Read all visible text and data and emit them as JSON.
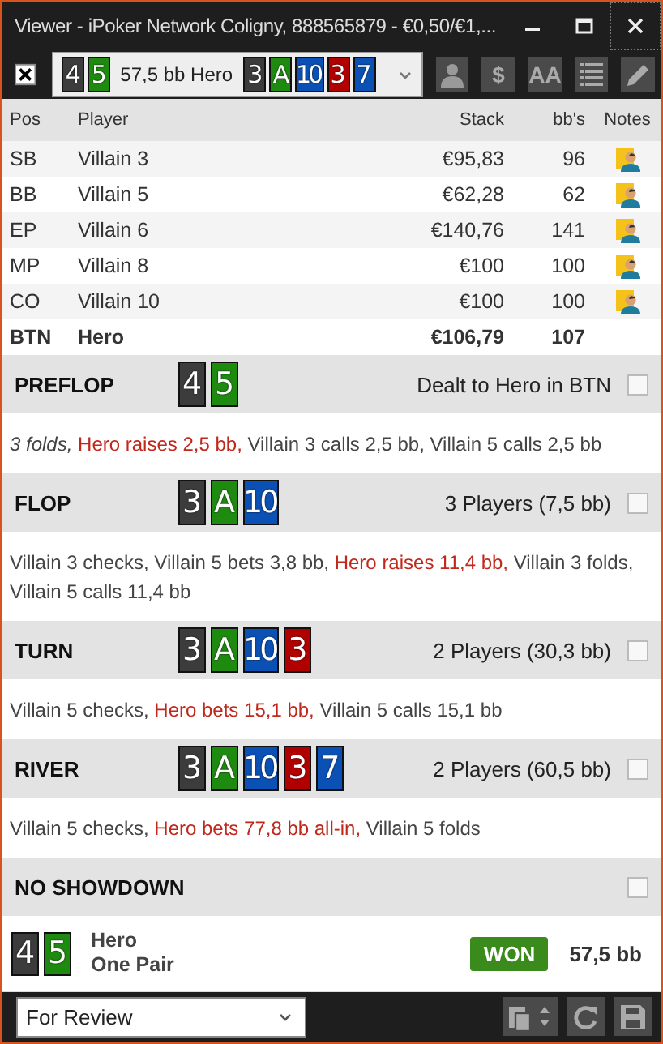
{
  "window": {
    "title": "Viewer - iPoker Network Coligny, 888565879 - €0,50/€1,..."
  },
  "toolbar": {
    "hand_selector": {
      "hero_cards": [
        {
          "rank": "4",
          "color": "#3c3c3c"
        },
        {
          "rank": "5",
          "color": "#1f8a10"
        }
      ],
      "label": "57,5 bb Hero",
      "board": [
        {
          "rank": "3",
          "color": "#3c3c3c"
        },
        {
          "rank": "A",
          "color": "#1f8a10"
        },
        {
          "rank": "10",
          "color": "#0b50b4"
        },
        {
          "rank": "3",
          "color": "#b10000"
        },
        {
          "rank": "7",
          "color": "#0b50b4"
        }
      ]
    },
    "buttons": [
      {
        "kind": "person"
      },
      {
        "kind": "text",
        "label": "$"
      },
      {
        "kind": "text",
        "label": "AA"
      },
      {
        "kind": "list"
      },
      {
        "kind": "pencil"
      }
    ]
  },
  "table": {
    "columns": [
      "Pos",
      "Player",
      "Stack",
      "bb's",
      "Notes"
    ],
    "rows": [
      {
        "pos": "SB",
        "player": "Villain 3",
        "stack": "€95,83",
        "bb": "96",
        "note": true,
        "hero": false
      },
      {
        "pos": "BB",
        "player": "Villain 5",
        "stack": "€62,28",
        "bb": "62",
        "note": true,
        "hero": false
      },
      {
        "pos": "EP",
        "player": "Villain 6",
        "stack": "€140,76",
        "bb": "141",
        "note": true,
        "hero": false
      },
      {
        "pos": "MP",
        "player": "Villain 8",
        "stack": "€100",
        "bb": "100",
        "note": true,
        "hero": false
      },
      {
        "pos": "CO",
        "player": "Villain 10",
        "stack": "€100",
        "bb": "100",
        "note": true,
        "hero": false
      },
      {
        "pos": "BTN",
        "player": "Hero",
        "stack": "€106,79",
        "bb": "107",
        "note": false,
        "hero": true
      }
    ]
  },
  "streets": [
    {
      "name": "PREFLOP",
      "cards": [
        {
          "rank": "4",
          "color": "#3c3c3c"
        },
        {
          "rank": "5",
          "color": "#1f8a10"
        }
      ],
      "info": "Dealt to Hero in BTN",
      "checked": false,
      "actions": [
        {
          "text": "3 folds,",
          "kind": "folds"
        },
        {
          "text": " Hero raises 2,5 bb,",
          "kind": "hero"
        },
        {
          "text": " Villain 3 calls 2,5 bb, Villain 5 calls 2,5 bb",
          "kind": "plain"
        }
      ]
    },
    {
      "name": "FLOP",
      "cards": [
        {
          "rank": "3",
          "color": "#3c3c3c"
        },
        {
          "rank": "A",
          "color": "#1f8a10"
        },
        {
          "rank": "10",
          "color": "#0b50b4"
        }
      ],
      "info": "3 Players (7,5 bb)",
      "checked": false,
      "actions": [
        {
          "text": "Villain 3 checks, Villain 5 bets 3,8 bb, ",
          "kind": "plain"
        },
        {
          "text": "Hero raises 11,4 bb,",
          "kind": "hero"
        },
        {
          "text": " Villain 3 folds, Villain 5 calls 11,4 bb",
          "kind": "plain"
        }
      ]
    },
    {
      "name": "TURN",
      "cards": [
        {
          "rank": "3",
          "color": "#3c3c3c"
        },
        {
          "rank": "A",
          "color": "#1f8a10"
        },
        {
          "rank": "10",
          "color": "#0b50b4"
        },
        {
          "rank": "3",
          "color": "#b10000"
        }
      ],
      "info": "2 Players (30,3 bb)",
      "checked": false,
      "actions": [
        {
          "text": "Villain 5 checks, ",
          "kind": "plain"
        },
        {
          "text": "Hero bets 15,1 bb,",
          "kind": "hero"
        },
        {
          "text": " Villain 5 calls 15,1 bb",
          "kind": "plain"
        }
      ]
    },
    {
      "name": "RIVER",
      "cards": [
        {
          "rank": "3",
          "color": "#3c3c3c"
        },
        {
          "rank": "A",
          "color": "#1f8a10"
        },
        {
          "rank": "10",
          "color": "#0b50b4"
        },
        {
          "rank": "3",
          "color": "#b10000"
        },
        {
          "rank": "7",
          "color": "#0b50b4"
        }
      ],
      "info": "2 Players (60,5 bb)",
      "checked": false,
      "actions": [
        {
          "text": "Villain 5 checks, ",
          "kind": "plain"
        },
        {
          "text": "Hero bets 77,8 bb all-in,",
          "kind": "hero"
        },
        {
          "text": " Villain 5 folds",
          "kind": "plain"
        }
      ]
    },
    {
      "name": "NO SHOWDOWN",
      "checked": false
    }
  ],
  "result": {
    "cards": [
      {
        "rank": "4",
        "color": "#3c3c3c"
      },
      {
        "rank": "5",
        "color": "#1f8a10"
      }
    ],
    "player": "Hero",
    "hand": "One Pair",
    "badge": "WON",
    "amount": "57,5 bb"
  },
  "bottom_bar": {
    "select": "For Review"
  }
}
